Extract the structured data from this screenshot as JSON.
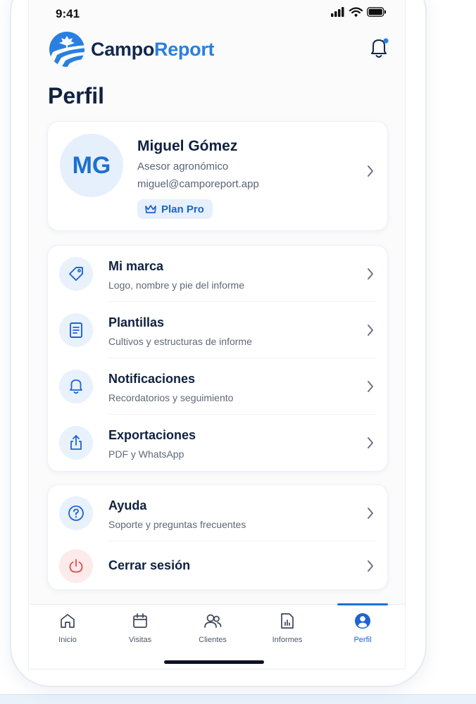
{
  "status_bar": {
    "time": "9:41"
  },
  "header": {
    "brand_part1": "Campo",
    "brand_part2": "Report",
    "notification_dot": true
  },
  "page": {
    "title": "Perfil"
  },
  "profile": {
    "initials": "MG",
    "name": "Miguel Gómez",
    "role": "Asesor agronómico",
    "email": "miguel@camporeport.app",
    "plan_badge": "Plan Pro"
  },
  "menu_primary": [
    {
      "title": "Mi marca",
      "subtitle": "Logo, nombre y pie del informe",
      "icon": "tag-icon"
    },
    {
      "title": "Plantillas",
      "subtitle": "Cultivos y estructuras de informe",
      "icon": "document-icon"
    },
    {
      "title": "Notificaciones",
      "subtitle": "Recordatorios y seguimiento",
      "icon": "bell-icon"
    },
    {
      "title": "Exportaciones",
      "subtitle": "PDF y WhatsApp",
      "icon": "share-icon"
    }
  ],
  "menu_secondary": [
    {
      "title": "Ayuda",
      "subtitle": "Soporte y preguntas frecuentes",
      "icon": "help-icon"
    },
    {
      "title": "Cerrar sesión",
      "icon": "power-icon"
    }
  ],
  "tabs": [
    {
      "label": "Inicio",
      "icon": "home-icon"
    },
    {
      "label": "Visitas",
      "icon": "calendar-icon"
    },
    {
      "label": "Clientes",
      "icon": "users-icon"
    },
    {
      "label": "Informes",
      "icon": "report-icon"
    },
    {
      "label": "Perfil",
      "icon": "profile-icon",
      "active": true
    }
  ],
  "colors": {
    "accent": "#1d6fe0",
    "brand_dark": "#12284f",
    "danger": "#e14b4b"
  }
}
